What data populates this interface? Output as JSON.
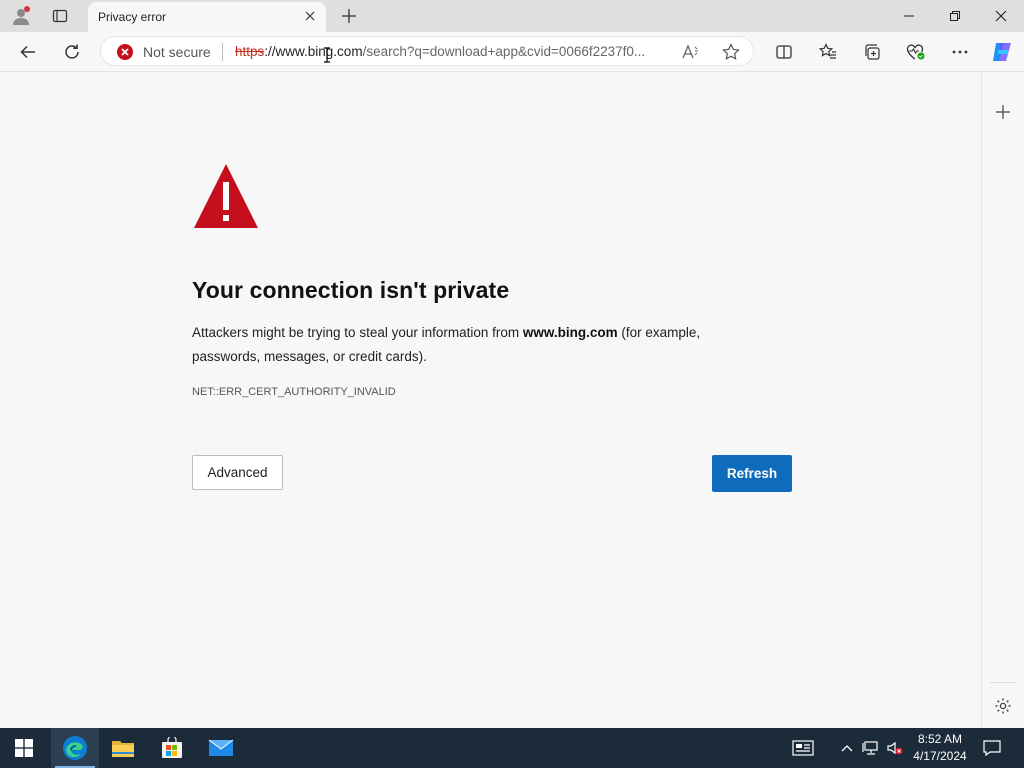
{
  "browser": {
    "tab_title": "Privacy error",
    "security_label": "Not secure",
    "url_scheme": "https",
    "url_host_prefix": "://www.bing.com",
    "url_rest": "/search?q=download+app&cvid=0066f2237f0..."
  },
  "error_page": {
    "heading": "Your connection isn't private",
    "desc_before": "Attackers might be trying to steal your information from ",
    "desc_host": "www.bing.com",
    "desc_after": " (for example, passwords, messages, or credit cards).",
    "error_code": "NET::ERR_CERT_AUTHORITY_INVALID",
    "advanced_label": "Advanced",
    "refresh_label": "Refresh"
  },
  "taskbar": {
    "time": "8:52 AM",
    "date": "4/17/2024"
  },
  "colors": {
    "warning_red": "#c50f1f",
    "refresh_blue": "#0f6cbd",
    "taskbar_bg": "#1c2b3a"
  }
}
